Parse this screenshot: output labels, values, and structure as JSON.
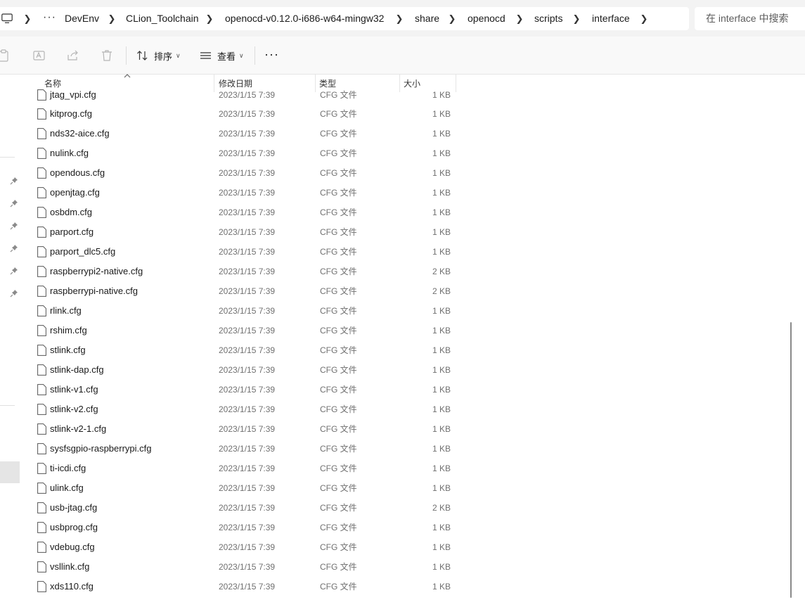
{
  "breadcrumb": {
    "overflow": "···",
    "items": [
      "DevEnv",
      "CLion_Toolchain",
      "openocd-v0.12.0-i686-w64-mingw32",
      "share",
      "openocd",
      "scripts",
      "interface"
    ]
  },
  "search": {
    "placeholder": "在 interface 中搜索"
  },
  "toolbar": {
    "sort_label": "排序",
    "view_label": "查看",
    "more_label": "···"
  },
  "columns": {
    "name": "名称",
    "date": "修改日期",
    "type": "类型",
    "size": "大小"
  },
  "files": [
    {
      "name": "jtag_vpi.cfg",
      "date": "2023/1/15 7:39",
      "type": "CFG 文件",
      "size": "1 KB"
    },
    {
      "name": "kitprog.cfg",
      "date": "2023/1/15 7:39",
      "type": "CFG 文件",
      "size": "1 KB"
    },
    {
      "name": "nds32-aice.cfg",
      "date": "2023/1/15 7:39",
      "type": "CFG 文件",
      "size": "1 KB"
    },
    {
      "name": "nulink.cfg",
      "date": "2023/1/15 7:39",
      "type": "CFG 文件",
      "size": "1 KB"
    },
    {
      "name": "opendous.cfg",
      "date": "2023/1/15 7:39",
      "type": "CFG 文件",
      "size": "1 KB"
    },
    {
      "name": "openjtag.cfg",
      "date": "2023/1/15 7:39",
      "type": "CFG 文件",
      "size": "1 KB"
    },
    {
      "name": "osbdm.cfg",
      "date": "2023/1/15 7:39",
      "type": "CFG 文件",
      "size": "1 KB"
    },
    {
      "name": "parport.cfg",
      "date": "2023/1/15 7:39",
      "type": "CFG 文件",
      "size": "1 KB"
    },
    {
      "name": "parport_dlc5.cfg",
      "date": "2023/1/15 7:39",
      "type": "CFG 文件",
      "size": "1 KB"
    },
    {
      "name": "raspberrypi2-native.cfg",
      "date": "2023/1/15 7:39",
      "type": "CFG 文件",
      "size": "2 KB"
    },
    {
      "name": "raspberrypi-native.cfg",
      "date": "2023/1/15 7:39",
      "type": "CFG 文件",
      "size": "2 KB"
    },
    {
      "name": "rlink.cfg",
      "date": "2023/1/15 7:39",
      "type": "CFG 文件",
      "size": "1 KB"
    },
    {
      "name": "rshim.cfg",
      "date": "2023/1/15 7:39",
      "type": "CFG 文件",
      "size": "1 KB"
    },
    {
      "name": "stlink.cfg",
      "date": "2023/1/15 7:39",
      "type": "CFG 文件",
      "size": "1 KB"
    },
    {
      "name": "stlink-dap.cfg",
      "date": "2023/1/15 7:39",
      "type": "CFG 文件",
      "size": "1 KB"
    },
    {
      "name": "stlink-v1.cfg",
      "date": "2023/1/15 7:39",
      "type": "CFG 文件",
      "size": "1 KB"
    },
    {
      "name": "stlink-v2.cfg",
      "date": "2023/1/15 7:39",
      "type": "CFG 文件",
      "size": "1 KB"
    },
    {
      "name": "stlink-v2-1.cfg",
      "date": "2023/1/15 7:39",
      "type": "CFG 文件",
      "size": "1 KB"
    },
    {
      "name": "sysfsgpio-raspberrypi.cfg",
      "date": "2023/1/15 7:39",
      "type": "CFG 文件",
      "size": "1 KB"
    },
    {
      "name": "ti-icdi.cfg",
      "date": "2023/1/15 7:39",
      "type": "CFG 文件",
      "size": "1 KB"
    },
    {
      "name": "ulink.cfg",
      "date": "2023/1/15 7:39",
      "type": "CFG 文件",
      "size": "1 KB"
    },
    {
      "name": "usb-jtag.cfg",
      "date": "2023/1/15 7:39",
      "type": "CFG 文件",
      "size": "2 KB"
    },
    {
      "name": "usbprog.cfg",
      "date": "2023/1/15 7:39",
      "type": "CFG 文件",
      "size": "1 KB"
    },
    {
      "name": "vdebug.cfg",
      "date": "2023/1/15 7:39",
      "type": "CFG 文件",
      "size": "1 KB"
    },
    {
      "name": "vsllink.cfg",
      "date": "2023/1/15 7:39",
      "type": "CFG 文件",
      "size": "1 KB"
    },
    {
      "name": "xds110.cfg",
      "date": "2023/1/15 7:39",
      "type": "CFG 文件",
      "size": "1 KB"
    }
  ]
}
